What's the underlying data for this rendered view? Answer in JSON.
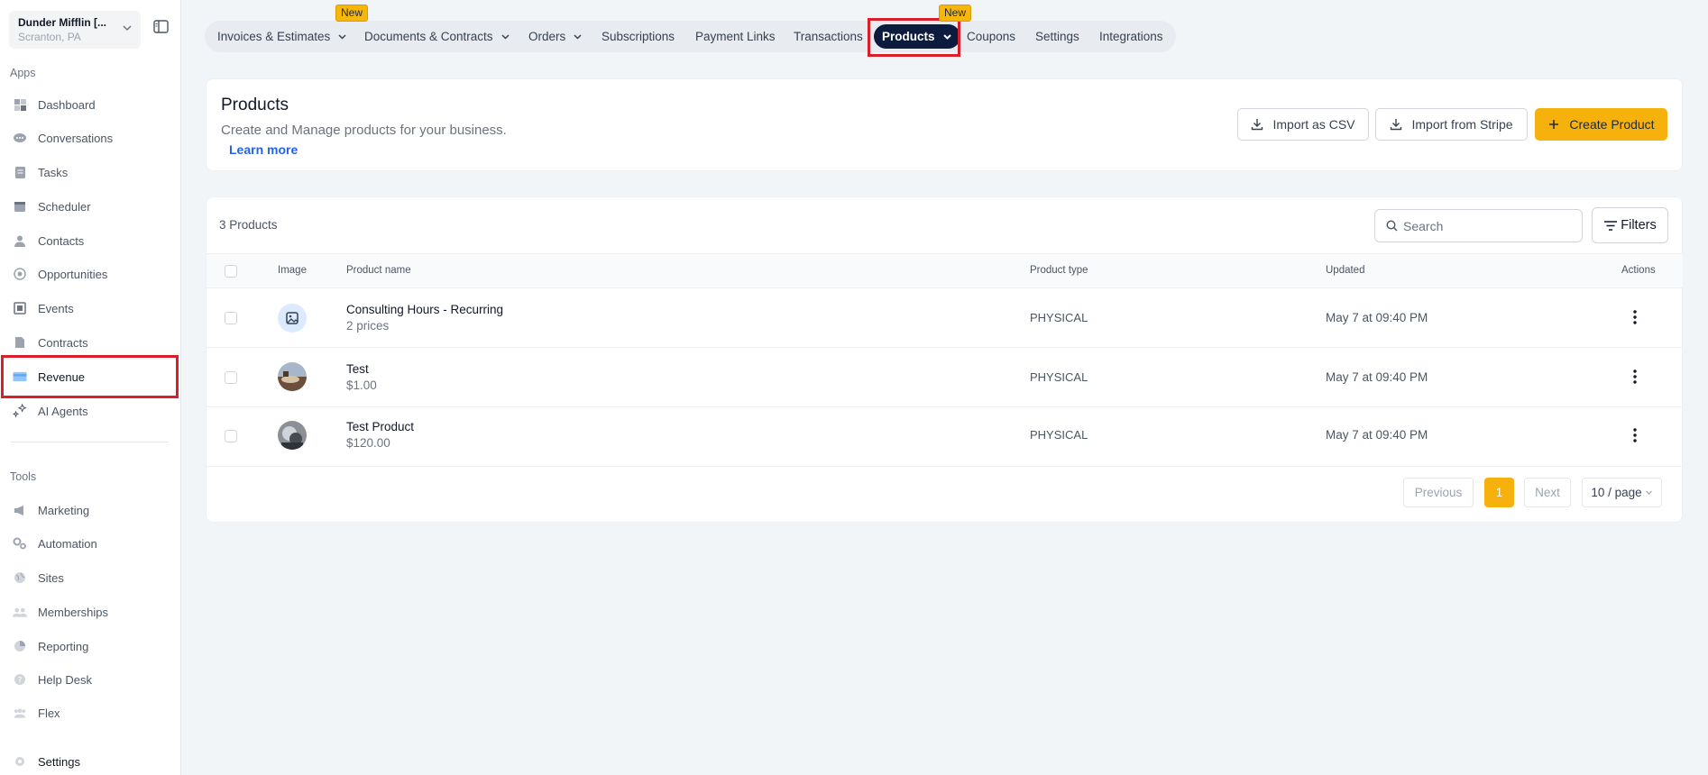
{
  "account": {
    "name": "Dunder Mifflin [...",
    "location": "Scranton, PA"
  },
  "sidebar": {
    "apps_label": "Apps",
    "tools_label": "Tools",
    "apps": [
      {
        "label": "Dashboard",
        "icon": "dashboard-icon"
      },
      {
        "label": "Conversations",
        "icon": "conversations-icon"
      },
      {
        "label": "Tasks",
        "icon": "tasks-icon"
      },
      {
        "label": "Scheduler",
        "icon": "calendar-icon"
      },
      {
        "label": "Contacts",
        "icon": "user-icon"
      },
      {
        "label": "Opportunities",
        "icon": "target-icon"
      },
      {
        "label": "Events",
        "icon": "events-icon"
      },
      {
        "label": "Contracts",
        "icon": "document-icon"
      },
      {
        "label": "Revenue",
        "icon": "credit-card-icon",
        "active": true
      },
      {
        "label": "AI Agents",
        "icon": "sparkle-icon"
      }
    ],
    "tools": [
      {
        "label": "Marketing",
        "icon": "megaphone-icon"
      },
      {
        "label": "Automation",
        "icon": "gears-icon"
      },
      {
        "label": "Sites",
        "icon": "globe-icon"
      },
      {
        "label": "Memberships",
        "icon": "users-icon"
      },
      {
        "label": "Reporting",
        "icon": "pie-chart-icon"
      },
      {
        "label": "Help Desk",
        "icon": "help-icon"
      },
      {
        "label": "Flex",
        "icon": "team-icon"
      }
    ],
    "settings_label": "Settings"
  },
  "tabs": [
    {
      "label": "Invoices & Estimates",
      "dropdown": true
    },
    {
      "label": "Documents & Contracts",
      "dropdown": true
    },
    {
      "label": "Orders",
      "dropdown": true
    },
    {
      "label": "Subscriptions"
    },
    {
      "label": "Payment Links"
    },
    {
      "label": "Transactions"
    },
    {
      "label": "Products",
      "dropdown": true,
      "active": true
    },
    {
      "label": "Coupons"
    },
    {
      "label": "Settings"
    },
    {
      "label": "Integrations"
    }
  ],
  "badges": {
    "new_1": "New",
    "new_2": "New"
  },
  "header": {
    "title": "Products",
    "subtitle": "Create and Manage products for your business.",
    "learn_more": "Learn more",
    "import_csv": "Import as CSV",
    "import_stripe": "Import from Stripe",
    "create_product": "Create Product"
  },
  "table": {
    "count_text": "3 Products",
    "search_placeholder": "Search",
    "filters_label": "Filters",
    "columns": {
      "image": "Image",
      "name": "Product name",
      "type": "Product type",
      "updated": "Updated",
      "actions": "Actions"
    },
    "rows": [
      {
        "name": "Consulting Hours - Recurring",
        "sub": "2 prices",
        "type": "PHYSICAL",
        "updated": "May 7 at 09:40 PM",
        "image": "placeholder-image-icon"
      },
      {
        "name": "Test",
        "sub": "$1.00",
        "type": "PHYSICAL",
        "updated": "May 7 at 09:40 PM",
        "image": "product-photo"
      },
      {
        "name": "Test Product",
        "sub": "$120.00",
        "type": "PHYSICAL",
        "updated": "May 7 at 09:40 PM",
        "image": "product-photo"
      }
    ]
  },
  "pagination": {
    "previous": "Previous",
    "current": "1",
    "next": "Next",
    "page_size": "10 / page"
  },
  "colors": {
    "accent": "#f6b10d",
    "active_tab": "#0d1b3e",
    "highlight": "#d9202a",
    "link": "#2563eb"
  }
}
